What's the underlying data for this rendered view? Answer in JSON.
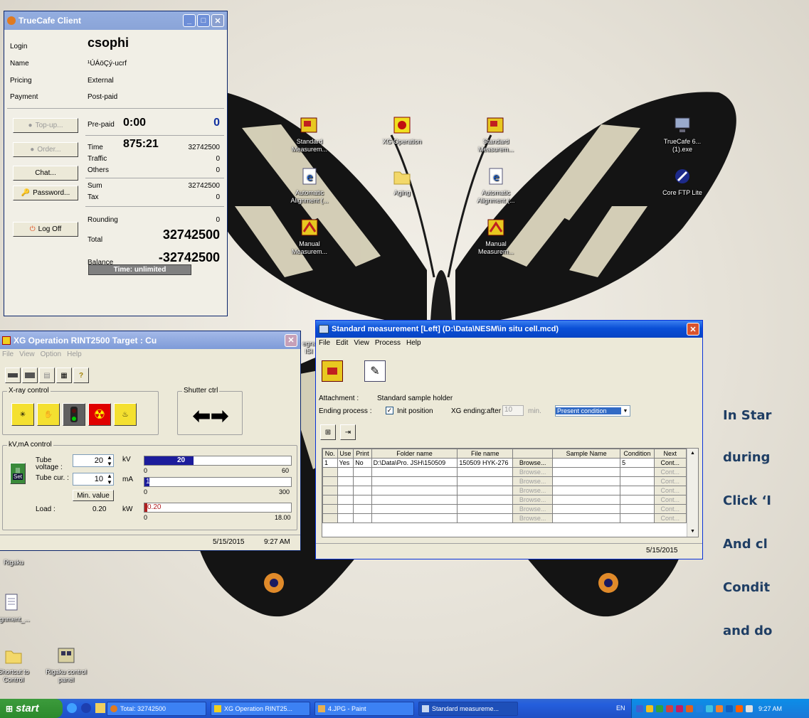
{
  "truecafe": {
    "title": "TrueCafe Client",
    "login_label": "Login",
    "login_value": "csophi",
    "name_label": "Name",
    "name_value": "¹ÚÁöÇý-ucrf",
    "pricing_label": "Pricing",
    "pricing_value": "External",
    "payment_label": "Payment",
    "payment_value": "Post-paid",
    "topup_label": "Top-up...",
    "order_label": "Order...",
    "chat_label": "Chat...",
    "password_label": "Password...",
    "logoff_label": "Log Off",
    "prepaid_label": "Pre-paid",
    "prepaid_value": "0:00",
    "prepaid_amount": "0",
    "time_label": "Time",
    "time_value": "875:21",
    "time_amount": "32742500",
    "traffic_label": "Traffic",
    "traffic_amount": "0",
    "others_label": "Others",
    "others_amount": "0",
    "sum_label": "Sum",
    "sum_amount": "32742500",
    "tax_label": "Tax",
    "tax_amount": "0",
    "rounding_label": "Rounding",
    "rounding_amount": "0",
    "total_label": "Total",
    "total_amount": "32742500",
    "balance_label": "Balance",
    "balance_amount": "-32742500",
    "time_status": "Time: unlimited"
  },
  "desktop_icons": {
    "std1": "Standard Measurem...",
    "xgop": "XG Operation",
    "std2": "Standard Measurem...",
    "truecafe": "TrueCafe 6... (1).exe",
    "autoalign1": "Automatic Alignment (...",
    "aging": "Aging",
    "autoalign2": "Automatic Alignment (...",
    "coreftp": "Core FTP Lite",
    "manual1": "Manual Measurem...",
    "manual2": "Manual Measurem...",
    "rigaku": "Rigaku",
    "alignment": "alignment_...",
    "shortcut": "Shortcut to Control",
    "rigakucp": "Rigaku control panel",
    "partial_integ": "egra",
    "partial_dsi": "ISI"
  },
  "xg": {
    "title": "XG Operation RINT2500  Target : Cu",
    "menu": [
      "File",
      "View",
      "Option",
      "Help"
    ],
    "xray_label": "X-ray control",
    "shutter_label": "Shutter ctrl",
    "kvma_label": "kV,mA control",
    "tube_voltage_label": "Tube voltage :",
    "tube_voltage_value": "20",
    "kv_unit": "kV",
    "tube_cur_label": "Tube cur. :",
    "tube_cur_value": "10",
    "ma_unit": "mA",
    "min_value_label": "Min. value",
    "load_label": "Load :",
    "load_value": "0.20",
    "kw_unit": "kW",
    "set_label": "Set",
    "kv_bar_text": "20",
    "kv_min": "0",
    "kv_max": "60",
    "kv_fraction": 0.333,
    "ma_bar_text": "10",
    "ma_min": "0",
    "ma_max": "300",
    "ma_fraction": 0.033,
    "kw_bar_text": "0.20",
    "kw_min": "0",
    "kw_max": "18.00",
    "kw_fraction": 0.011,
    "date": "5/15/2015",
    "time": "9:27 AM"
  },
  "std": {
    "title": "Standard measurement [Left] (D:\\Data\\NESM\\in situ cell.mcd)",
    "menu": [
      "File",
      "Edit",
      "View",
      "Process",
      "Help"
    ],
    "attachment_label": "Attachment :",
    "attachment_value": "Standard sample holder",
    "ending_label": "Ending process :",
    "init_position_label": "Init position",
    "xg_ending_label": "XG ending:after",
    "xg_ending_value": "10",
    "min_label": "min.",
    "condition_select": "Present condition",
    "columns": [
      "No.",
      "Use",
      "Print",
      "Folder name",
      "File name",
      "",
      "Sample Name",
      "Condition",
      "Next"
    ],
    "row1": {
      "no": "1",
      "use": "Yes",
      "print": "No",
      "folder": "D:\\Data\\Pro. JSH\\150509",
      "file": "150509 HYK-276",
      "browse": "Browse...",
      "sample": "",
      "condition": "5",
      "next": "Cont..."
    },
    "browse_label": "Browse...",
    "cont_label": "Cont...",
    "date": "5/15/2015"
  },
  "instructions": [
    "In Star",
    "during",
    "Click ‘I",
    "And cl",
    "Condit",
    "and do"
  ],
  "taskbar": {
    "start_label": "start",
    "tasks": [
      "Total: 32742500",
      "XG Operation RINT25...",
      "4.JPG - Paint",
      "Standard measureme..."
    ],
    "lang": "EN",
    "clock": "9:27 AM"
  }
}
